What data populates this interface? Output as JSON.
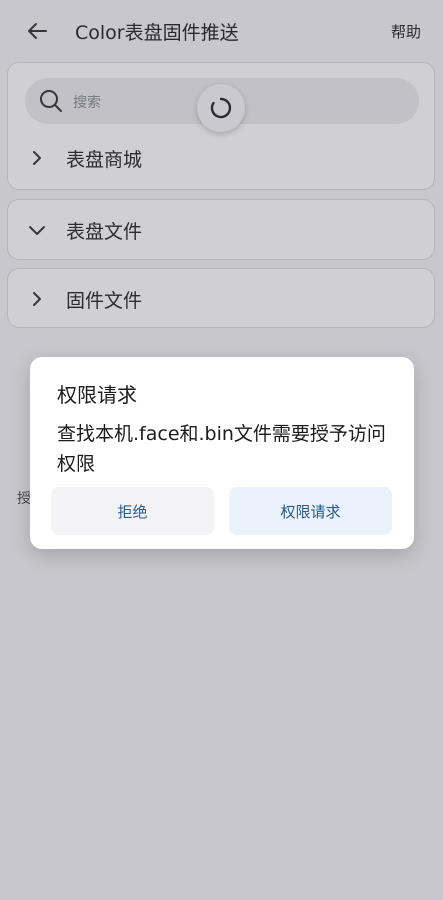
{
  "header": {
    "title": "Color表盘固件推送",
    "help_label": "帮助",
    "back_icon": "arrow-left-icon"
  },
  "search": {
    "placeholder": "搜索",
    "icon": "search-icon"
  },
  "sections": [
    {
      "label": "表盘商城",
      "expanded": false
    },
    {
      "label": "表盘文件",
      "expanded": true
    },
    {
      "label": "固件文件",
      "expanded": false
    }
  ],
  "background_text": "授",
  "dialog": {
    "title": "权限请求",
    "message": "查找本机.face和.bin文件需要授予访问权限",
    "deny_label": "拒绝",
    "grant_label": "权限请求"
  },
  "colors": {
    "accent_text": "#2a5a88",
    "grant_bg": "#eaf3fb"
  }
}
